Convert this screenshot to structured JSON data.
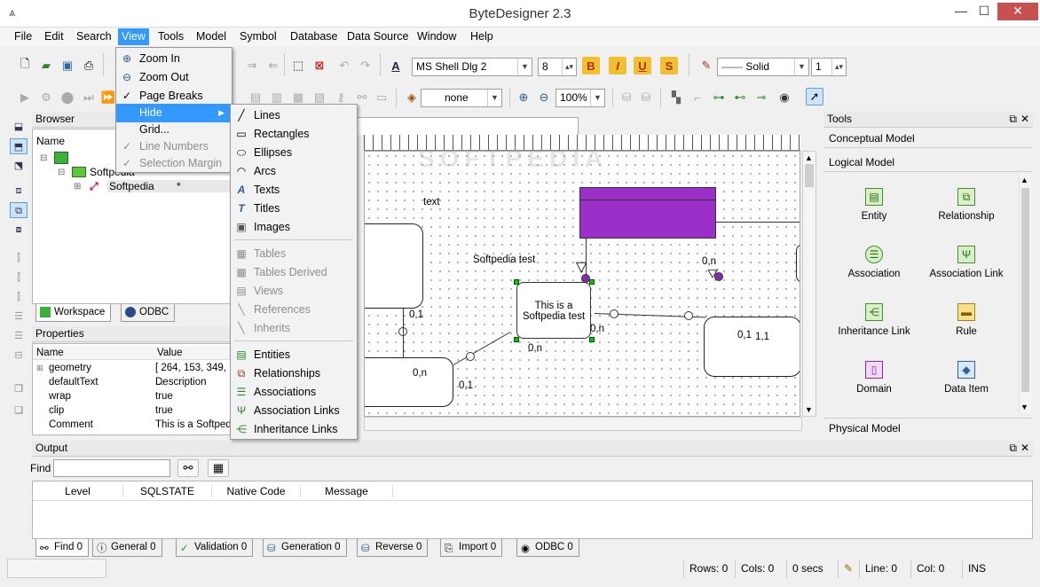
{
  "window": {
    "title": "ByteDesigner 2.3",
    "minimize": "—",
    "maximize": "☐",
    "close": "✕",
    "app_icon": "⩓"
  },
  "menubar": [
    "File",
    "Edit",
    "Search",
    "View",
    "Tools",
    "Model",
    "Symbol",
    "Database",
    "Data Source",
    "Window",
    "Help"
  ],
  "toolbar": {
    "font_name": "MS Shell Dlg 2",
    "font_size": "8",
    "line_style": "Solid",
    "line_width": "1",
    "fill": "none",
    "zoom": "100%"
  },
  "view_menu": {
    "items": [
      {
        "label": "Zoom In",
        "icon": "zoom-in-icon",
        "glyph": "⊕",
        "state": "normal"
      },
      {
        "label": "Zoom Out",
        "icon": "zoom-out-icon",
        "glyph": "⊖",
        "state": "normal"
      },
      {
        "label": "Page Breaks",
        "icon": "check-icon",
        "glyph": "✓",
        "state": "normal"
      },
      {
        "label": "Hide",
        "icon": "",
        "glyph": "",
        "state": "highlighted",
        "submenu_arrow": "▶"
      },
      {
        "label": "Grid...",
        "icon": "",
        "glyph": "",
        "state": "normal"
      },
      {
        "label": "Line Numbers",
        "icon": "check-icon",
        "glyph": "✓",
        "state": "disabled"
      },
      {
        "label": "Selection Margin",
        "icon": "check-icon",
        "glyph": "✓",
        "state": "disabled"
      }
    ]
  },
  "hide_submenu": {
    "group1": [
      {
        "label": "Lines",
        "icon": "line-icon",
        "glyph": "╱"
      },
      {
        "label": "Rectangles",
        "icon": "rectangle-icon",
        "glyph": "▭"
      },
      {
        "label": "Ellipses",
        "icon": "ellipse-icon",
        "glyph": "⬭"
      },
      {
        "label": "Arcs",
        "icon": "arc-icon",
        "glyph": "◠"
      },
      {
        "label": "Texts",
        "icon": "text-icon",
        "glyph": "A"
      },
      {
        "label": "Titles",
        "icon": "title-icon",
        "glyph": "T"
      },
      {
        "label": "Images",
        "icon": "image-icon",
        "glyph": "▣"
      }
    ],
    "group2": [
      {
        "label": "Tables",
        "icon": "table-icon",
        "glyph": "▦"
      },
      {
        "label": "Tables Derived",
        "icon": "table-derived-icon",
        "glyph": "▦"
      },
      {
        "label": "Views",
        "icon": "view-icon",
        "glyph": "▤"
      },
      {
        "label": "References",
        "icon": "reference-icon",
        "glyph": "╲"
      },
      {
        "label": "Inherits",
        "icon": "inherit-icon",
        "glyph": "╲"
      }
    ],
    "group3": [
      {
        "label": "Entities",
        "icon": "entity-icon",
        "glyph": "▤"
      },
      {
        "label": "Relationships",
        "icon": "relationship-icon",
        "glyph": "⧉"
      },
      {
        "label": "Associations",
        "icon": "association-icon",
        "glyph": "☰"
      },
      {
        "label": "Association Links",
        "icon": "association-link-icon",
        "glyph": "Ψ"
      },
      {
        "label": "Inheritance Links",
        "icon": "inheritance-link-icon",
        "glyph": "⋲"
      }
    ]
  },
  "browser": {
    "title": "Browser",
    "column_name": "Name",
    "tree": [
      {
        "label": "Softpedia",
        "level": 1
      },
      {
        "label": "Softpedia",
        "level": 2,
        "flag": "*"
      }
    ],
    "tabs": [
      "Workspace",
      "ODBC"
    ]
  },
  "properties": {
    "title": "Properties",
    "columns": [
      "Name",
      "Value"
    ],
    "rows": [
      {
        "name": "geometry",
        "value": "[ 264, 153, 349, ..."
      },
      {
        "name": "defaultText",
        "value": "Description"
      },
      {
        "name": "wrap",
        "value": "true"
      },
      {
        "name": "clip",
        "value": "true"
      },
      {
        "name": "Comment",
        "value": "This is a Softpedia"
      }
    ]
  },
  "canvas": {
    "labels": {
      "text": "text",
      "softpedia_test": "Softpedia test",
      "note_line1": "This is a",
      "note_line2": "Softpedia test",
      "c1": "0,1",
      "c2": "0,n",
      "c3": "0,1",
      "c4": "0,n",
      "c5": "0,n",
      "c6": "0,1",
      "c7": "1,1",
      "c8": "0,n"
    },
    "entity_color": "#9b30c8",
    "watermark": "SOFTPEDIA"
  },
  "tools": {
    "title": "Tools",
    "sections": {
      "conceptual": "Conceptual Model",
      "logical": "Logical Model",
      "physical": "Physical Model"
    },
    "items": [
      "Entity",
      "Relationship",
      "Association",
      "Association Link",
      "Inheritance Link",
      "Rule",
      "Domain",
      "Data Item"
    ]
  },
  "output": {
    "title": "Output",
    "find_label": "Find",
    "find_value": "",
    "columns": [
      "Level",
      "SQLSTATE",
      "Native Code",
      "Message"
    ],
    "tabs": [
      "Find 0",
      "General 0",
      "Validation 0",
      "Generation 0",
      "Reverse 0",
      "Import 0",
      "ODBC 0"
    ]
  },
  "statusbar": {
    "rows": "Rows: 0",
    "cols": "Cols: 0",
    "secs": "0 secs",
    "line": "Line: 0",
    "col": "Col: 0",
    "mode": "INS"
  }
}
